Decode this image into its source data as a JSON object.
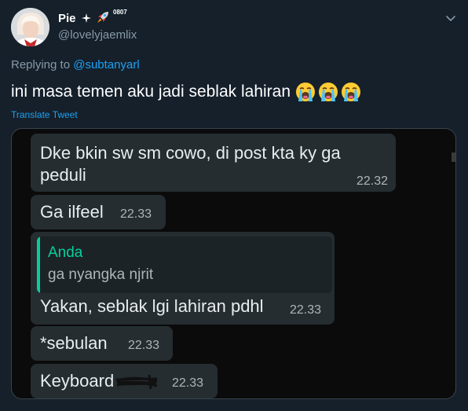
{
  "header": {
    "display_name": "Pie",
    "name_badge": "0807",
    "handle": "@lovelyjaemlix"
  },
  "reply": {
    "prefix": "Replying to ",
    "mention": "@subtanyarl"
  },
  "tweet": {
    "text": "ini masa temen aku jadi seblak lahiran",
    "emojis": [
      "loudly-crying-face",
      "loudly-crying-face",
      "loudly-crying-face"
    ],
    "translate_label": "Translate Tweet"
  },
  "chat": {
    "messages": [
      {
        "line1": "Dke bkin sw sm cowo, di post kta ky ga",
        "line2": "peduli",
        "time": "22.32"
      },
      {
        "text": "Ga ilfeel",
        "time": "22.33"
      },
      {
        "quote_author": "Anda",
        "quote_text": "ga nyangka njrit",
        "text": "Yakan, seblak lgi lahiran pdhl",
        "time": "22.33"
      },
      {
        "text": "*sebulan",
        "time": "22.33"
      },
      {
        "text": "Keyboard",
        "time": "22.33"
      }
    ]
  },
  "colors": {
    "background": "#15202b",
    "link": "#1da1f2",
    "secondary_text": "#8899a6",
    "chat_background": "#0b0b0b",
    "bubble": "#252d31",
    "quote_accent": "#06cf9c"
  }
}
